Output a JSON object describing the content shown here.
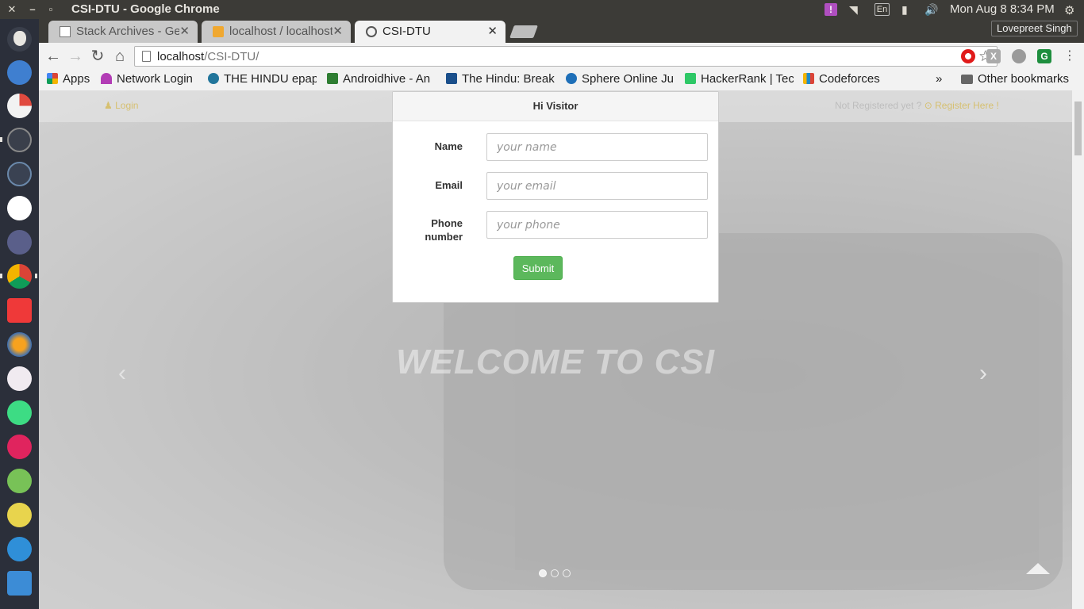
{
  "desktop": {
    "window_title": "CSI-DTU - Google Chrome",
    "clock": "Mon Aug  8  8:34 PM",
    "keyboard_layout": "En"
  },
  "browser": {
    "tabs": [
      {
        "label": "Stack Archives - Gee",
        "icon": "page-icon",
        "active": false
      },
      {
        "label": "localhost / localhost",
        "icon": "phpmyadmin-icon",
        "active": false
      },
      {
        "label": "CSI-DTU",
        "icon": "site-icon",
        "active": true
      }
    ],
    "profile_name": "Lovepreet Singh",
    "url_host": "localhost",
    "url_path": "/CSI-DTU/",
    "bookmarks": [
      {
        "label": "Apps",
        "icon": "apps-grid-icon",
        "color": "#4285f4"
      },
      {
        "label": "Network Login",
        "icon": "umbrella-icon",
        "color": "#b23cb5"
      },
      {
        "label": "THE HINDU epaper",
        "icon": "wordpress-icon",
        "color": "#21759b"
      },
      {
        "label": "Androidhive - An",
        "icon": "androidhive-icon",
        "color": "#2e7d32"
      },
      {
        "label": "The Hindu: Break",
        "icon": "th-icon",
        "color": "#1a4f8b"
      },
      {
        "label": "Sphere Online Ju",
        "icon": "spoj-icon",
        "color": "#1e6fb8"
      },
      {
        "label": "HackerRank | Tec",
        "icon": "hackerrank-icon",
        "color": "#2ec866"
      },
      {
        "label": "Codeforces",
        "icon": "codeforces-icon",
        "color": "#1f8acb"
      }
    ],
    "other_bookmarks": "Other bookmarks",
    "overflow": "»"
  },
  "page": {
    "nav": {
      "login_label": "Login",
      "register_prefix": "Not Registered yet ?",
      "register_link": "Register Here !"
    },
    "hero_title": "WELCOME TO CSI",
    "modal": {
      "title": "Hi Visitor",
      "fields": [
        {
          "label": "Name",
          "placeholder": "your name",
          "value": ""
        },
        {
          "label": "Email",
          "placeholder": "your email",
          "value": ""
        },
        {
          "label": "Phone number",
          "placeholder": "your phone",
          "value": ""
        }
      ],
      "submit_label": "Submit"
    },
    "carousel": {
      "slides": 3,
      "active_slide": 1
    }
  },
  "colors": {
    "submit": "#5cb85c",
    "nav_highlight": "#d6c070",
    "launcher_bg": "#2b2f3a"
  }
}
